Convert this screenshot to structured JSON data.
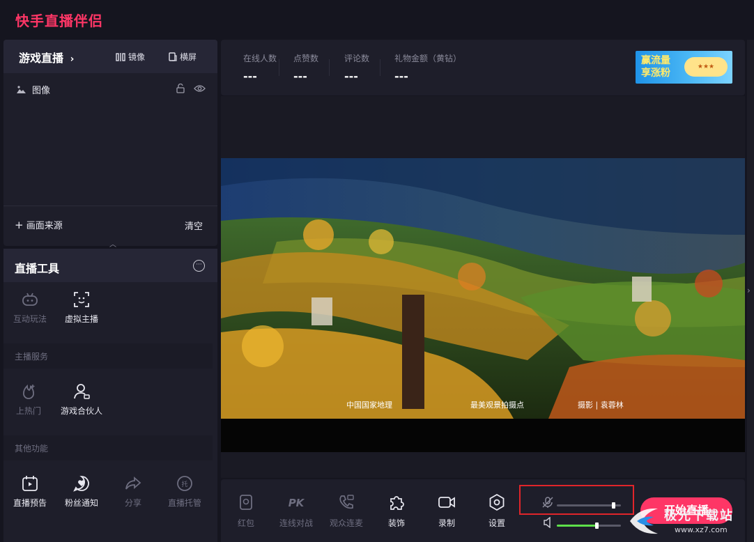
{
  "app": {
    "title": "快手直播伴侣"
  },
  "scene": {
    "title": "游戏直播",
    "mirror_label": "镜像",
    "landscape_label": "横屏",
    "sources": [
      {
        "label": "图像"
      }
    ],
    "add_source_label": "画面来源",
    "clear_label": "清空"
  },
  "tools": {
    "title": "直播工具",
    "row1": [
      {
        "label": "互动玩法",
        "enabled": false
      },
      {
        "label": "虚拟主播",
        "enabled": true
      }
    ],
    "section_host": "主播服务",
    "row2": [
      {
        "label": "上热门",
        "enabled": false
      },
      {
        "label": "游戏合伙人",
        "enabled": true
      }
    ],
    "section_other": "其他功能",
    "row3": [
      {
        "label": "直播预告",
        "enabled": true
      },
      {
        "label": "粉丝通知",
        "enabled": true
      },
      {
        "label": "分享",
        "enabled": false
      },
      {
        "label": "直播托管",
        "enabled": false
      }
    ]
  },
  "stats": [
    {
      "label": "在线人数",
      "value": "---"
    },
    {
      "label": "点赞数",
      "value": "---"
    },
    {
      "label": "评论数",
      "value": "---"
    },
    {
      "label": "礼物金额（黄钻）",
      "value": "---"
    }
  ],
  "promo": {
    "line1": "赢流量",
    "line2": "享涨粉"
  },
  "preview": {
    "watermarks": [
      "中国国家地理",
      "最美观景拍摄点",
      "摄影 | 袁蓉林"
    ]
  },
  "bottom": {
    "buttons": [
      {
        "label": "红包",
        "enabled": false
      },
      {
        "label": "连线对战",
        "enabled": false
      },
      {
        "label": "观众连麦",
        "enabled": false
      },
      {
        "label": "装饰",
        "enabled": true
      },
      {
        "label": "录制",
        "enabled": true
      },
      {
        "label": "设置",
        "enabled": true
      }
    ],
    "mic_level": 0.88,
    "speaker_level": 0.62,
    "go_live_label": "开始直播"
  },
  "site_watermark": {
    "text": "极光下载站",
    "url": "www.xz7.com"
  },
  "colors": {
    "accent": "#fe3666",
    "panel": "#1e1e2a",
    "speaker": "#5ee04a",
    "highlight_box": "#e0252a"
  }
}
